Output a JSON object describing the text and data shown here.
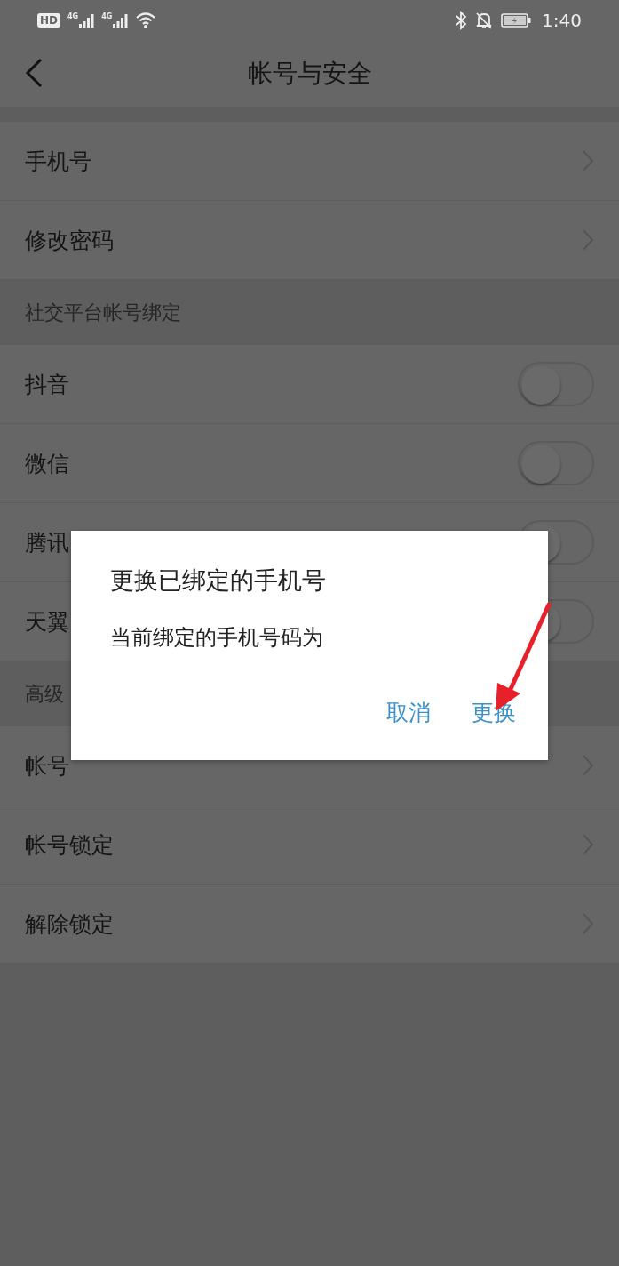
{
  "status_bar": {
    "hd": "HD",
    "networks": [
      "4G",
      "4G"
    ],
    "time": "1:40"
  },
  "header": {
    "title": "帐号与安全"
  },
  "groups": [
    {
      "items": [
        {
          "label": "手机号",
          "kind": "link"
        },
        {
          "label": "修改密码",
          "kind": "link"
        }
      ]
    },
    {
      "header": "社交平台帐号绑定",
      "items": [
        {
          "label": "抖音",
          "kind": "toggle",
          "on": false
        },
        {
          "label": "微信",
          "kind": "toggle",
          "on": false
        },
        {
          "label": "腾讯",
          "kind": "toggle",
          "on": false
        },
        {
          "label": "天翼",
          "kind": "toggle",
          "on": false
        }
      ]
    },
    {
      "header": "高级",
      "items": [
        {
          "label": "帐号",
          "kind": "link"
        },
        {
          "label": "帐号锁定",
          "kind": "link"
        },
        {
          "label": "解除锁定",
          "kind": "link"
        }
      ]
    }
  ],
  "dialog": {
    "title": "更换已绑定的手机号",
    "message": "当前绑定的手机号码为",
    "buttons": [
      "取消",
      "更换"
    ]
  }
}
